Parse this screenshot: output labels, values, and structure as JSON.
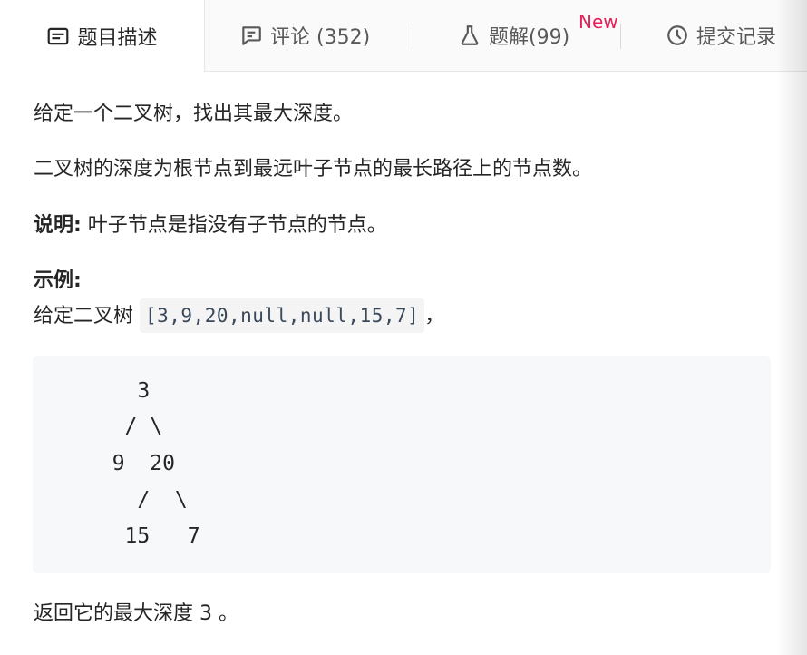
{
  "tabs": [
    {
      "label": "题目描述",
      "icon": "description-icon"
    },
    {
      "label": "评论 (352)",
      "icon": "comment-icon"
    },
    {
      "label": "题解(99)",
      "icon": "flask-icon",
      "badge": "New"
    },
    {
      "label": "提交记录",
      "icon": "clock-icon"
    }
  ],
  "content": {
    "line1": "给定一个二叉树，找出其最大深度。",
    "line2": "二叉树的深度为根节点到最远叶子节点的最长路径上的节点数。",
    "note_label": "说明:",
    "note_text": " 叶子节点是指没有子节点的节点。",
    "example_label": "示例:",
    "example_prefix": "给定二叉树 ",
    "example_code": "[3,9,20,null,null,15,7]",
    "example_suffix": "，",
    "tree_lines": [
      "    3",
      "   / \\",
      "  9  20",
      "    /  \\",
      "   15   7"
    ],
    "return_text": "返回它的最大深度 3 。"
  },
  "colors": {
    "accent_badge": "#e6205b",
    "tab_bg": "#fafafa",
    "code_bg": "#f7f8fa"
  }
}
